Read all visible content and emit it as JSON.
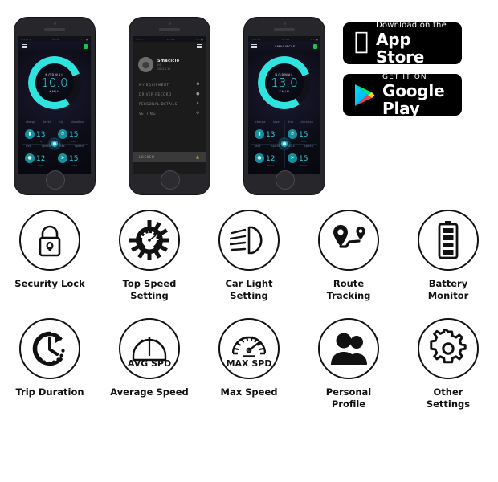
{
  "phones": [
    {
      "id": "phone-dashboard-1",
      "statusbar": {
        "carrier": "••••• ▾",
        "time": "12:30",
        "right": "• • ■"
      },
      "navbar": {
        "title": "",
        "menu_icon": "hamburger-icon",
        "right_icon": "bluetooth-icon"
      },
      "gauge": {
        "mode": "NORMAL",
        "value": "10.0",
        "unit": "KM/H",
        "color": "#2fe3de"
      },
      "metrics": [
        {
          "label_left": "charge",
          "label_right": "level",
          "icon": "battery-icon",
          "value": "13",
          "unit": "%"
        },
        {
          "label_left": "trip",
          "label_right": "duration",
          "icon": "stopwatch-icon",
          "value": "15",
          "unit": "min"
        },
        {
          "label_left": "ave",
          "label_right": "speed",
          "icon": "gauge-icon",
          "value": "12",
          "unit": "km/h"
        },
        {
          "label_left": "max",
          "label_right": "speed",
          "icon": "speed-icon",
          "value": "15",
          "unit": "km/h"
        }
      ]
    },
    {
      "id": "phone-drawer-2",
      "statusbar": {
        "carrier": "••••• ▾",
        "time": "12:30",
        "right": "• • ■"
      },
      "navbar": {
        "title": "",
        "menu_icon": "hamburger-icon",
        "right_icon": ""
      },
      "profile": {
        "name": "Smaciclo",
        "line1": "US",
        "line2": "2013.5.15",
        "avatar": "user-avatar"
      },
      "menu": [
        {
          "label": "MY EQUIPMENT",
          "icon": "scooter-icon"
        },
        {
          "label": "DRIVER RECORD",
          "icon": "pin-icon"
        },
        {
          "label": "PERSONAL DETAILS",
          "icon": "person-icon"
        },
        {
          "label": "SETTING",
          "icon": "gear-icon"
        }
      ],
      "locked": {
        "label": "LOCKED",
        "icon": "lock-icon"
      }
    },
    {
      "id": "phone-dashboard-3",
      "statusbar": {
        "carrier": "••••• ▾",
        "time": "12:30",
        "right": "• • ■"
      },
      "navbar": {
        "title": "SMACIRCLE",
        "menu_icon": "hamburger-icon",
        "right_icon": "bluetooth-icon"
      },
      "gauge": {
        "mode": "NORMAL",
        "value": "13.0",
        "unit": "KM/H",
        "color": "#2fe3de"
      },
      "metrics": [
        {
          "label_left": "charge",
          "label_right": "level",
          "icon": "battery-icon",
          "value": "13",
          "unit": "%"
        },
        {
          "label_left": "trip",
          "label_right": "duration",
          "icon": "stopwatch-icon",
          "value": "15",
          "unit": "min"
        },
        {
          "label_left": "ave",
          "label_right": "speed",
          "icon": "gauge-icon",
          "value": "12",
          "unit": "km/h"
        },
        {
          "label_left": "max",
          "label_right": "speed",
          "icon": "speed-icon",
          "value": "15",
          "unit": "km/h"
        }
      ]
    }
  ],
  "badges": {
    "apple": {
      "small": "Download on the",
      "big": "App Store",
      "icon": "apple-logo-icon"
    },
    "google": {
      "small": "GET IT ON",
      "big": "Google Play",
      "icon": "google-play-icon"
    }
  },
  "features": [
    {
      "label": "Security Lock",
      "icon": "padlock-icon"
    },
    {
      "label": "Top Speed\nSetting",
      "label_l1": "Top Speed",
      "label_l2": "Setting",
      "icon": "gear-speed-icon"
    },
    {
      "label": "Car Light\nSetting",
      "label_l1": "Car Light",
      "label_l2": "Setting",
      "icon": "headlight-icon"
    },
    {
      "label": "Route\nTracking",
      "label_l1": "Route",
      "label_l2": "Tracking",
      "icon": "route-pin-icon"
    },
    {
      "label": "Battery\nMonitor",
      "label_l1": "Battery",
      "label_l2": "Monitor",
      "icon": "battery-full-icon"
    },
    {
      "label": "Trip Duration",
      "label_l1": "Trip Duration",
      "label_l2": "",
      "icon": "clock-arrow-icon"
    },
    {
      "label": "Average Speed",
      "label_l1": "Average Speed",
      "label_l2": "",
      "icon": "avg-spd-gauge-icon",
      "inner_text": "AVG SPD"
    },
    {
      "label": "Max Speed",
      "label_l1": "Max Speed",
      "label_l2": "",
      "icon": "max-spd-gauge-icon",
      "inner_text": "MAX SPD"
    },
    {
      "label": "Personal\nProfile",
      "label_l1": "Personal",
      "label_l2": "Profile",
      "icon": "people-icon"
    },
    {
      "label": "Other\nSettings",
      "label_l1": "Other",
      "label_l2": "Settings",
      "icon": "cog-icon"
    }
  ],
  "colors": {
    "accent_cyan": "#2fe3de",
    "teal": "#14919c",
    "phone_body": "#27272b",
    "ink": "#111111"
  }
}
